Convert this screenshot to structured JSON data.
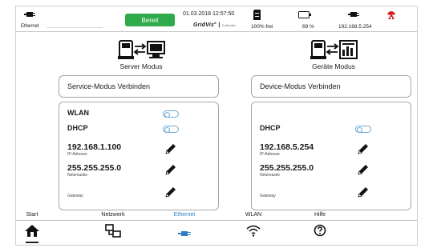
{
  "statusbar": {
    "ethernet_label": "Ethernet",
    "status_badge": "Bereit",
    "datetime": "01.03.2018 12:57:50",
    "brand": "GridVis",
    "brand_sub": "Collector",
    "storage_label": "100% frei",
    "battery_label": "69 %",
    "ip_label": "192.168.5.254"
  },
  "left": {
    "title": "Server Modus",
    "connect_button": "Service-Modus Verbinden",
    "wlan_label": "WLAN",
    "dhcp_label": "DHCP",
    "ip": "192.168.1.100",
    "ip_sub": "IP-Adresse",
    "netmask": "255.255.255.0",
    "netmask_sub": "Netzmaske",
    "gateway_sub": "Gateway"
  },
  "right": {
    "title": "Geräte Modus",
    "connect_button": "Device-Modus Verbinden",
    "dhcp_label": "DHCP",
    "ip": "192.168.5.254",
    "ip_sub": "IP-Adresse",
    "netmask": "255.255.255.0",
    "netmask_sub": "Netzmaske",
    "gateway_sub": "Gateway"
  },
  "nav": {
    "start": "Start",
    "netzwerk": "Netzwerk",
    "ethernet": "Ethernet",
    "wlan": "WLAN",
    "hilfe": "Hilfe"
  },
  "colors": {
    "ready_green": "#2eaa4a",
    "active_blue": "#2f7fc1",
    "toggle_blue": "#6aa9d6",
    "alarm_red": "#d11f1f"
  },
  "icons": [
    "ethernet-icon",
    "sd-card-icon",
    "battery-icon",
    "alarm-icon",
    "server-mode-icon",
    "device-mode-icon",
    "pencil-icon",
    "home-icon",
    "network-icon",
    "wifi-icon",
    "help-icon"
  ]
}
